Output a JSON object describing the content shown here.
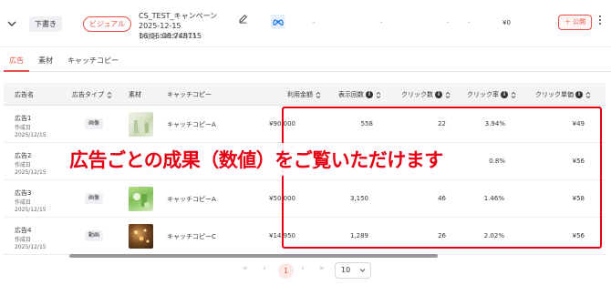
{
  "campaign": {
    "status_badge": "下書き",
    "type_badge": "ビジュアル",
    "name": "CS_TEST_キャンペーン 2025-12-15 16:06:08.748715",
    "created": "作成日 2025/12/15",
    "dashes": [
      "-",
      "-",
      "-",
      "-"
    ],
    "spend": "¥0",
    "publish_label": "＋ 公開",
    "icons": {
      "expand": "chevron-down-icon",
      "edit": "pencil-icon",
      "platform": "meta-icon",
      "more": "kebab-icon"
    }
  },
  "tabs": [
    {
      "label": "広告",
      "active": true
    },
    {
      "label": "素材",
      "active": false
    },
    {
      "label": "キャッチコピー",
      "active": false
    }
  ],
  "table": {
    "headers": {
      "name": "広告名",
      "type": "広告タイプ",
      "asset": "素材",
      "catch": "キャッチコピー",
      "spend": "利用金額",
      "impressions": "表示回数",
      "clicks": "クリック数",
      "ctr": "クリック率",
      "cpc": "クリック単価"
    },
    "rows": [
      {
        "name": "広告1",
        "created_label": "作成日",
        "created": "2025/12/15",
        "type": "画像",
        "catch": "キャッチコピーA",
        "spend": "¥90,000",
        "impressions": "558",
        "clicks": "22",
        "ctr": "3.94%",
        "cpc": "¥49"
      },
      {
        "name": "広告2",
        "created_label": "作成日",
        "created": "2025/12/15",
        "type": "",
        "catch": "",
        "spend": "",
        "impressions": "",
        "clicks": "",
        "ctr": "0.8%",
        "cpc": "¥56"
      },
      {
        "name": "広告3",
        "created_label": "作成日",
        "created": "2025/12/15",
        "type": "画像",
        "catch": "キャッチコピーA",
        "spend": "¥50,000",
        "impressions": "3,150",
        "clicks": "46",
        "ctr": "1.46%",
        "cpc": "¥58"
      },
      {
        "name": "広告4",
        "created_label": "作成日",
        "created": "2025/12/15",
        "type": "動画",
        "catch": "キャッチコピーC",
        "spend": "¥14,950",
        "impressions": "1,289",
        "clicks": "26",
        "ctr": "2.02%",
        "cpc": "¥56"
      }
    ]
  },
  "annotation": "広告ごとの成果（数値）をご覧いただけます",
  "pagination": {
    "first": "«",
    "prev": "‹",
    "current": "1",
    "next": "›",
    "last": "»",
    "page_size": "10"
  },
  "colors": {
    "accent": "#e5534b",
    "annotation": "#e60012"
  }
}
